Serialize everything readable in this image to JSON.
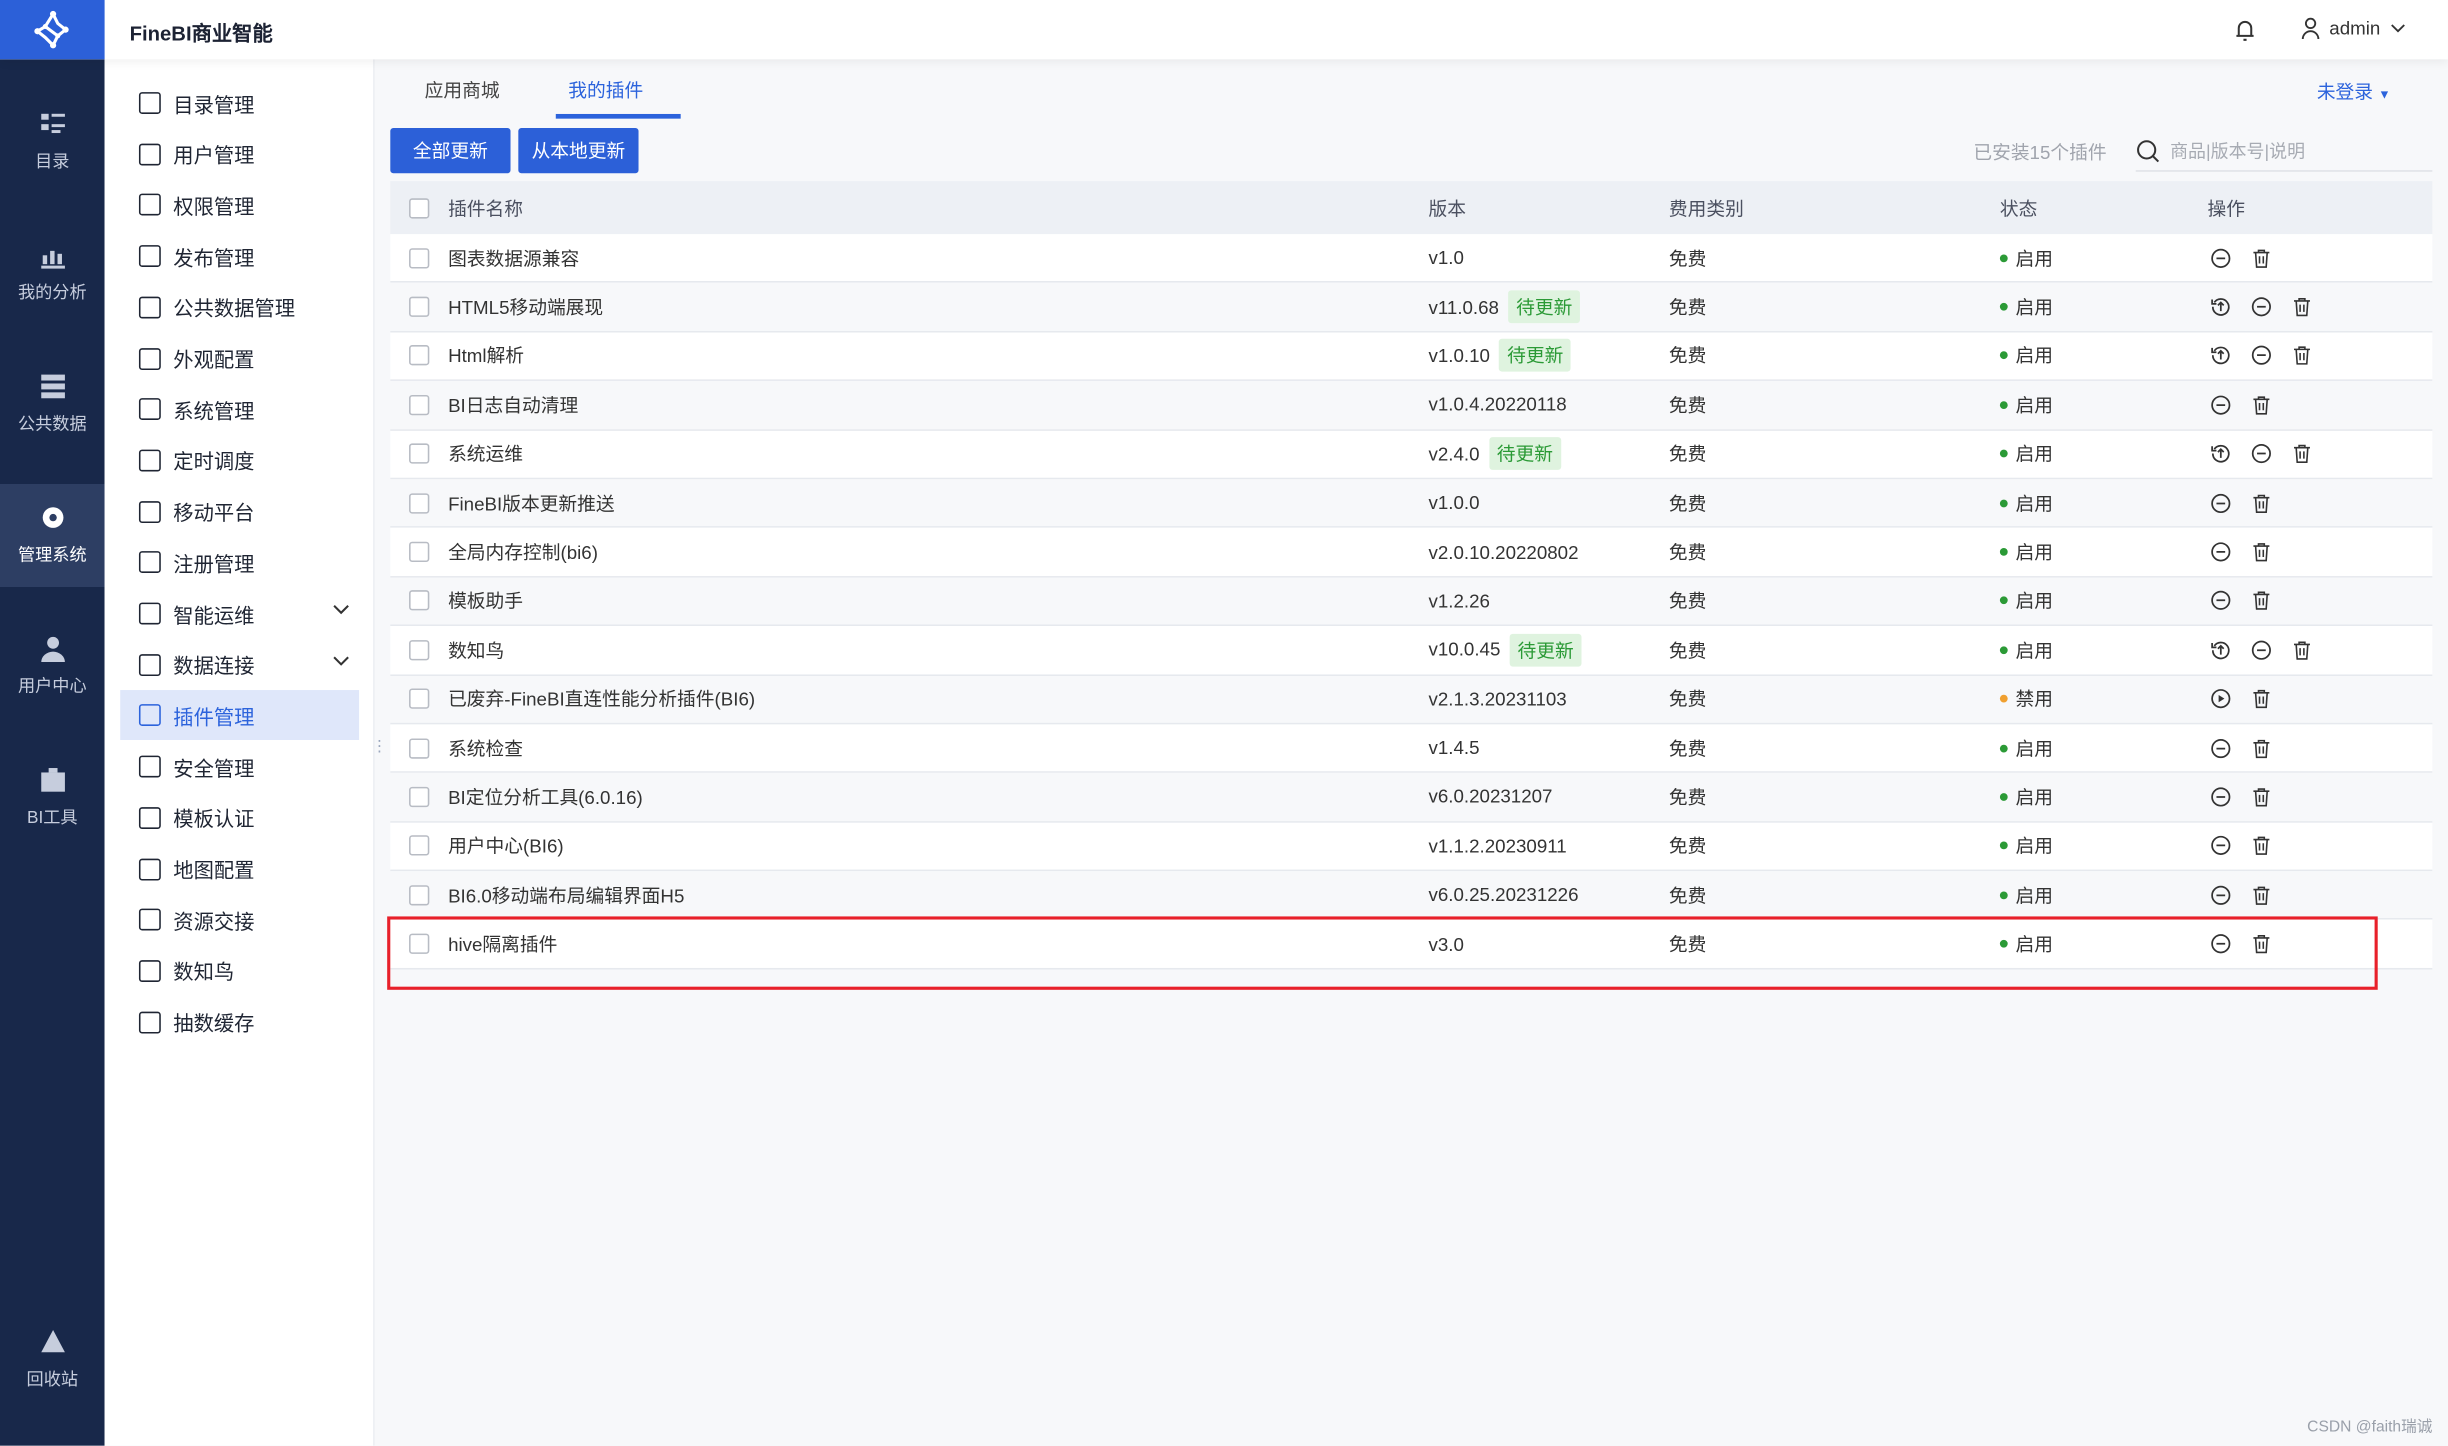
{
  "header": {
    "brand": "FineBI商业智能",
    "user": "admin"
  },
  "nav": [
    {
      "label": "目录",
      "icon": "catalog-icon"
    },
    {
      "label": "我的分析",
      "icon": "analysis-icon"
    },
    {
      "label": "公共数据",
      "icon": "database-icon"
    },
    {
      "label": "管理系统",
      "icon": "gear-icon",
      "active": true
    },
    {
      "label": "用户中心",
      "icon": "user-icon"
    },
    {
      "label": "BI工具",
      "icon": "toolbox-icon"
    },
    {
      "label": "回收站",
      "icon": "recycle-icon"
    }
  ],
  "menu": [
    {
      "label": "目录管理"
    },
    {
      "label": "用户管理"
    },
    {
      "label": "权限管理"
    },
    {
      "label": "发布管理"
    },
    {
      "label": "公共数据管理"
    },
    {
      "label": "外观配置"
    },
    {
      "label": "系统管理"
    },
    {
      "label": "定时调度"
    },
    {
      "label": "移动平台"
    },
    {
      "label": "注册管理"
    },
    {
      "label": "智能运维",
      "expandable": true
    },
    {
      "label": "数据连接",
      "expandable": true
    },
    {
      "label": "插件管理",
      "active": true
    },
    {
      "label": "安全管理"
    },
    {
      "label": "模板认证"
    },
    {
      "label": "地图配置"
    },
    {
      "label": "资源交接"
    },
    {
      "label": "数知鸟"
    },
    {
      "label": "抽数缓存"
    }
  ],
  "tabs": [
    "应用商城",
    "我的插件"
  ],
  "login": "未登录",
  "toolbar": {
    "update_all": "全部更新",
    "update_local": "从本地更新",
    "installed": "已安装15个插件",
    "search_placeholder": "商品|版本号|说明"
  },
  "columns": [
    "插件名称",
    "版本",
    "费用类别",
    "状态",
    "操作"
  ],
  "rows": [
    {
      "name": "图表数据源兼容",
      "version": "v1.0",
      "tag": "",
      "fee": "免费",
      "status": "启用",
      "upgrade": false
    },
    {
      "name": "HTML5移动端展现",
      "version": "v11.0.68",
      "tag": "待更新",
      "fee": "免费",
      "status": "启用",
      "upgrade": true
    },
    {
      "name": "Html解析",
      "version": "v1.0.10",
      "tag": "待更新",
      "fee": "免费",
      "status": "启用",
      "upgrade": true
    },
    {
      "name": "BI日志自动清理",
      "version": "v1.0.4.20220118",
      "tag": "",
      "fee": "免费",
      "status": "启用",
      "upgrade": false
    },
    {
      "name": "系统运维",
      "version": "v2.4.0",
      "tag": "待更新",
      "fee": "免费",
      "status": "启用",
      "upgrade": true
    },
    {
      "name": "FineBI版本更新推送",
      "version": "v1.0.0",
      "tag": "",
      "fee": "免费",
      "status": "启用",
      "upgrade": false
    },
    {
      "name": "全局内存控制(bi6)",
      "version": "v2.0.10.20220802",
      "tag": "",
      "fee": "免费",
      "status": "启用",
      "upgrade": false
    },
    {
      "name": "模板助手",
      "version": "v1.2.26",
      "tag": "",
      "fee": "免费",
      "status": "启用",
      "upgrade": false
    },
    {
      "name": "数知鸟",
      "version": "v10.0.45",
      "tag": "待更新",
      "fee": "免费",
      "status": "启用",
      "upgrade": true
    },
    {
      "name": "已废弃-FineBI直连性能分析插件(BI6)",
      "version": "v2.1.3.20231103",
      "tag": "",
      "fee": "免费",
      "status": "禁用",
      "upgrade": false,
      "disabled": true
    },
    {
      "name": "系统检查",
      "version": "v1.4.5",
      "tag": "",
      "fee": "免费",
      "status": "启用",
      "upgrade": false
    },
    {
      "name": "BI定位分析工具(6.0.16)",
      "version": "v6.0.20231207",
      "tag": "",
      "fee": "免费",
      "status": "启用",
      "upgrade": false
    },
    {
      "name": "用户中心(BI6)",
      "version": "v1.1.2.20230911",
      "tag": "",
      "fee": "免费",
      "status": "启用",
      "upgrade": false
    },
    {
      "name": "BI6.0移动端布局编辑界面H5",
      "version": "v6.0.25.20231226",
      "tag": "",
      "fee": "免费",
      "status": "启用",
      "upgrade": false
    },
    {
      "name": "hive隔离插件",
      "version": "v3.0",
      "tag": "",
      "fee": "免费",
      "status": "启用",
      "upgrade": false
    }
  ],
  "colors": {
    "accent": "#2c60d8",
    "enabled": "#2b9a36",
    "disabled": "#f0a030",
    "highlight": "#e8202a"
  },
  "watermark": "CSDN @faith瑞诚"
}
